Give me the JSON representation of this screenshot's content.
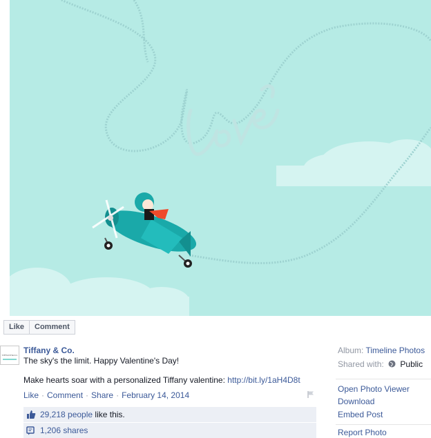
{
  "photo": {
    "like_label": "Like",
    "comment_label": "Comment",
    "sky_color": "#b6ebe5",
    "plane_color": "#1aa9a9",
    "scarf_color": "#ef4a2a",
    "chain_color": "#9dd2d0"
  },
  "post": {
    "author": "Tiffany & Co.",
    "logo_text": "TIFFANY&CO.",
    "line1": "The sky's the limit. Happy Valentine's Day!",
    "line2_prefix": "Make hearts soar with a personalized Tiffany valentine: ",
    "link": "http://bit.ly/1aH4D8t",
    "actions": {
      "like": "Like",
      "comment": "Comment",
      "share": "Share",
      "date": "February 14, 2014",
      "separator": "·"
    },
    "likes_link": "29,218 people",
    "likes_suffix": " like this.",
    "shares": "1,206 shares"
  },
  "sidebar": {
    "album_label": "Album:",
    "album_value": "Timeline Photos",
    "shared_label": "Shared with:",
    "shared_value": "Public",
    "links": {
      "open_viewer": "Open Photo Viewer",
      "download": "Download",
      "embed": "Embed Post",
      "report": "Report Photo"
    }
  }
}
